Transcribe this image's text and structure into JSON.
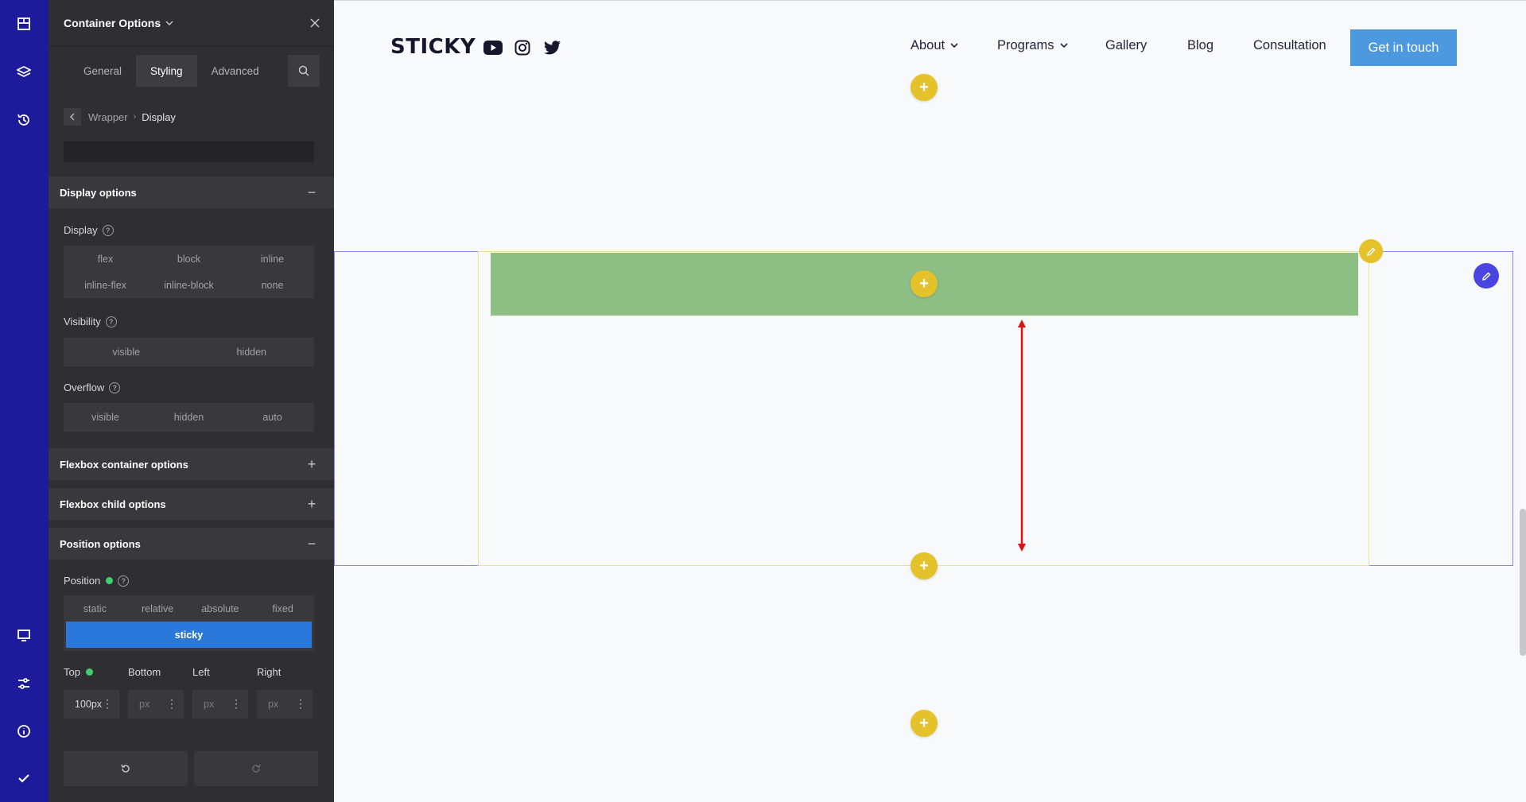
{
  "rail": {
    "items": [
      "layout-icon",
      "layers-icon",
      "history-icon",
      "desktop-icon",
      "settings-sliders-icon",
      "info-icon",
      "check-icon"
    ]
  },
  "panel": {
    "title": "Container Options",
    "tabs": [
      {
        "label": "General"
      },
      {
        "label": "Styling",
        "active": true
      },
      {
        "label": "Advanced"
      }
    ],
    "breadcrumb": {
      "parent": "Wrapper",
      "sep": "›",
      "current": "Display"
    },
    "display_options": {
      "heading": "Display options",
      "display_label": "Display",
      "display_values": [
        "flex",
        "block",
        "inline",
        "inline-flex",
        "inline-block",
        "none"
      ],
      "visibility_label": "Visibility",
      "visibility_values": [
        "visible",
        "hidden"
      ],
      "overflow_label": "Overflow",
      "overflow_values": [
        "visible",
        "hidden",
        "auto"
      ]
    },
    "flexbox_container": {
      "heading": "Flexbox container options"
    },
    "flexbox_child": {
      "heading": "Flexbox child options"
    },
    "position_options": {
      "heading": "Position options",
      "position_label": "Position",
      "position_values": [
        "static",
        "relative",
        "absolute",
        "fixed"
      ],
      "active_value": "sticky",
      "top_label": "Top",
      "bottom_label": "Bottom",
      "left_label": "Left",
      "right_label": "Right",
      "top_value": "100px",
      "unit_placeholder": "px"
    },
    "collapse_sign": "−",
    "expand_sign": "+"
  },
  "site": {
    "logo": "STICKY",
    "nav": {
      "about": "About",
      "programs": "Programs",
      "gallery": "Gallery",
      "blog": "Blog",
      "consultation": "Consultation"
    },
    "cta": "Get in touch",
    "add_symbol": "+"
  },
  "colors": {
    "rail": "#1d1a9b",
    "panel": "#2f2f33",
    "active_option": "#2b78dd",
    "add_button": "#e5c12a",
    "green_bar": "#8ebf85",
    "cta": "#4d99e0",
    "arrow": "#e01010"
  }
}
